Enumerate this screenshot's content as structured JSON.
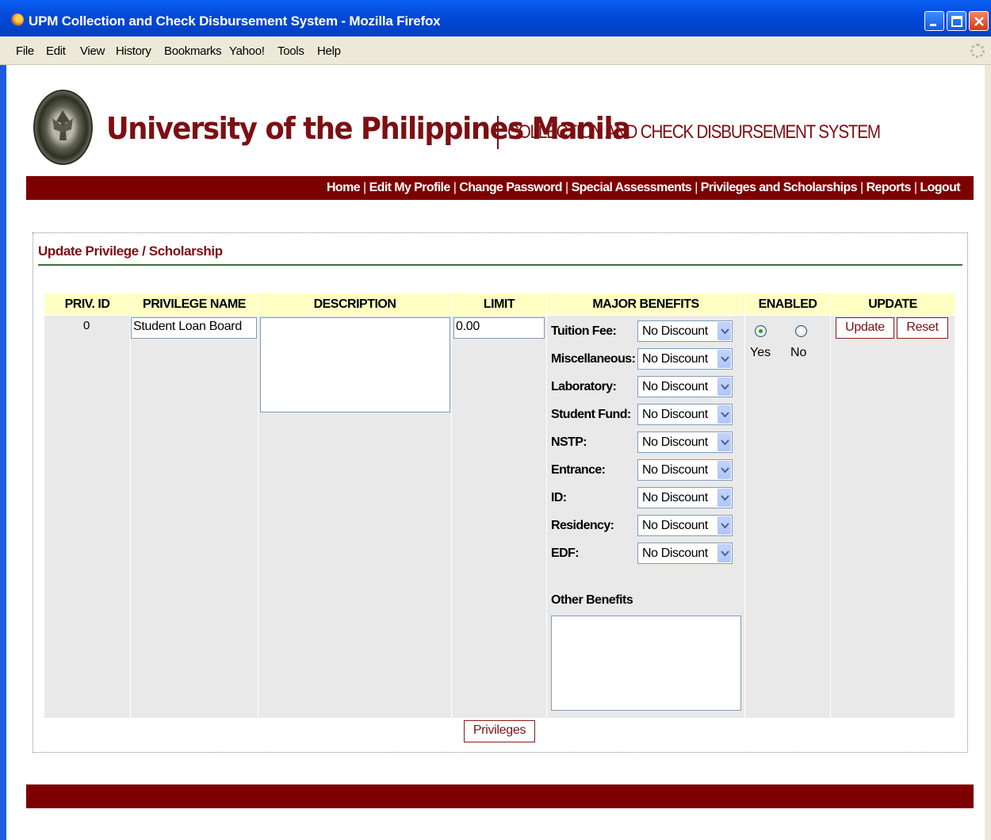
{
  "window": {
    "title": "UPM Collection and Check Disbursement System - Mozilla Firefox"
  },
  "menu": [
    "File",
    "Edit",
    "View",
    "History",
    "Bookmarks",
    "Yahoo!",
    "Tools",
    "Help"
  ],
  "header": {
    "university": "University of the Philippines Manila",
    "system_name": "COLLECTION AND CHECK DISBURSEMENT SYSTEM"
  },
  "nav": [
    "Home",
    "Edit My Profile",
    "Change Password",
    "Special Assessments",
    "Privileges and Scholarships",
    "Reports",
    "Logout"
  ],
  "form": {
    "title": "Update Privilege / Scholarship",
    "columns": [
      "PRIV. ID",
      "PRIVILEGE NAME",
      "DESCRIPTION",
      "LIMIT",
      "MAJOR BENEFITS",
      "ENABLED",
      "UPDATE"
    ],
    "priv_id": "0",
    "privilege_name": "Student Loan Board",
    "description": "",
    "limit": "0.00",
    "benefits": [
      {
        "label": "Tuition Fee:",
        "value": "No Discount"
      },
      {
        "label": "Miscellaneous:",
        "value": "No Discount"
      },
      {
        "label": "Laboratory:",
        "value": "No Discount"
      },
      {
        "label": "Student Fund:",
        "value": "No Discount"
      },
      {
        "label": "NSTP:",
        "value": "No Discount"
      },
      {
        "label": "Entrance:",
        "value": "No Discount"
      },
      {
        "label": "ID:",
        "value": "No Discount"
      },
      {
        "label": "Residency:",
        "value": "No Discount"
      },
      {
        "label": "EDF:",
        "value": "No Discount"
      }
    ],
    "other_benefits_label": "Other Benefits",
    "other_benefits": "",
    "enabled": {
      "yes": "Yes",
      "no": "No",
      "selected": "Yes"
    },
    "update_button": "Update",
    "reset_button": "Reset",
    "privileges_button": "Privileges"
  }
}
